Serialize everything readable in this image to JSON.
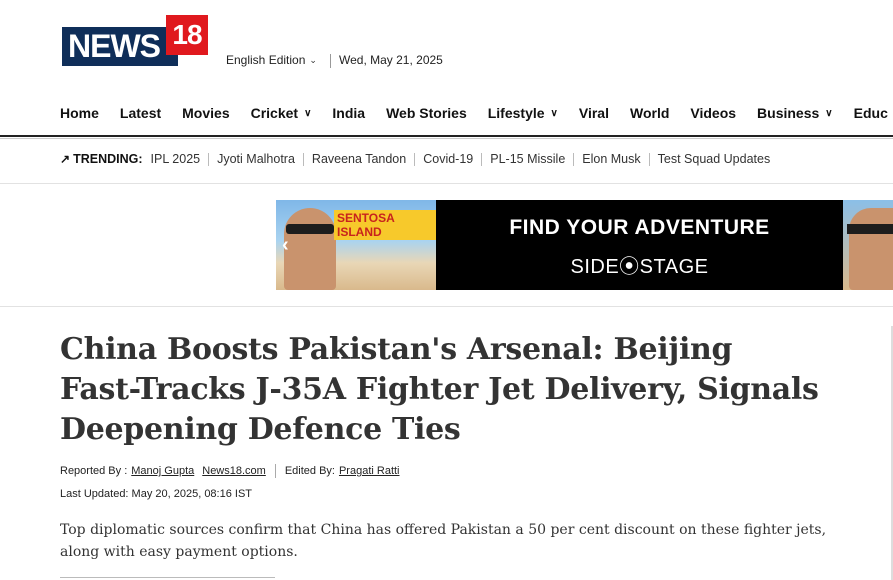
{
  "logo": {
    "news_text": "NEWS",
    "number_text": "18",
    "brand_blue": "#0f2e59",
    "brand_red": "#e0191e"
  },
  "header": {
    "edition_label": "English Edition",
    "date": "Wed, May 21, 2025"
  },
  "nav": {
    "items": [
      {
        "label": "Home",
        "has_dropdown": false
      },
      {
        "label": "Latest",
        "has_dropdown": false
      },
      {
        "label": "Movies",
        "has_dropdown": false
      },
      {
        "label": "Cricket",
        "has_dropdown": true
      },
      {
        "label": "India",
        "has_dropdown": false
      },
      {
        "label": "Web Stories",
        "has_dropdown": false
      },
      {
        "label": "Lifestyle",
        "has_dropdown": true
      },
      {
        "label": "Viral",
        "has_dropdown": false
      },
      {
        "label": "World",
        "has_dropdown": false
      },
      {
        "label": "Videos",
        "has_dropdown": false
      },
      {
        "label": "Business",
        "has_dropdown": true
      },
      {
        "label": "Educ",
        "has_dropdown": false
      }
    ]
  },
  "trending": {
    "label": "TRENDING:",
    "items": [
      "IPL 2025",
      "Jyoti Malhotra",
      "Raveena Tandon",
      "Covid-19",
      "PL-15 Missile",
      "Elon Musk",
      "Test Squad Updates"
    ]
  },
  "ad": {
    "thumb_badge": "SENTOSA ISLAND",
    "headline": "FIND YOUR ADVENTURE",
    "brand": "SIDE⦿STAGE"
  },
  "article": {
    "headline": "China Boosts Pakistan's Arsenal: Beijing Fast-Tracks J-35A Fighter Jet Delivery, Signals Deepening Defence Ties",
    "reported_by_label": "Reported By :",
    "reporter": "Manoj Gupta",
    "outlet": "News18.com",
    "edited_by_label": "Edited By:",
    "editor": "Pragati Ratti",
    "last_updated": "Last Updated: May 20, 2025, 08:16 IST",
    "summary": "Top diplomatic sources confirm that China has offered Pakistan a 50 per cent discount on these fighter jets, along with easy payment options."
  }
}
